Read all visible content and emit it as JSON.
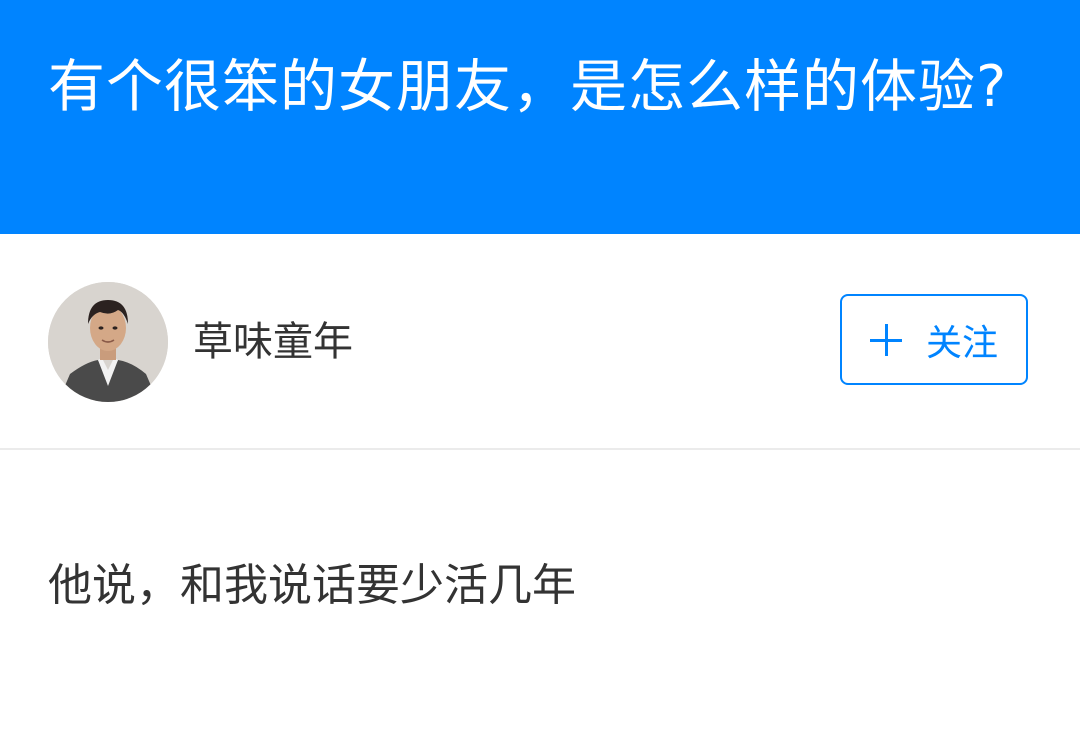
{
  "question": {
    "title": "有个很笨的女朋友，是怎么样的体验?"
  },
  "author": {
    "name": "草味童年",
    "avatar_icon": "avatar-photo"
  },
  "follow_button": {
    "icon": "plus-icon",
    "label": "关注"
  },
  "answer": {
    "text": "他说，和我说话要少活几年"
  },
  "colors": {
    "brand": "#0084ff",
    "text": "#333333",
    "divider": "#ebebeb"
  }
}
